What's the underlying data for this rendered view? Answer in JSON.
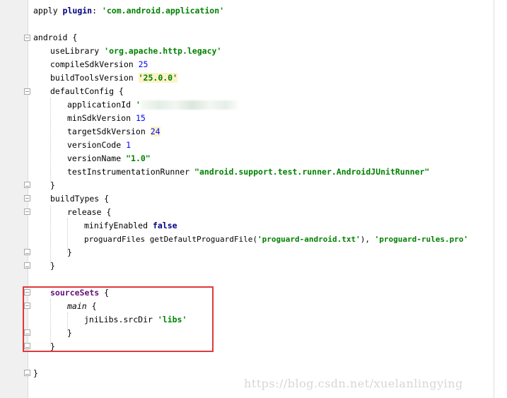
{
  "code": {
    "l1_apply": "apply ",
    "l1_plugin": "plugin",
    "l1_colon": ": ",
    "l1_str": "'com.android.application'",
    "l2_android": "android {",
    "l3_use": "useLibrary ",
    "l3_str": "'org.apache.http.legacy'",
    "l4_key": "compileSdkVersion ",
    "l4_val": "25",
    "l5_key": "buildToolsVersion ",
    "l5_val": "'25.0.0'",
    "l6": "defaultConfig {",
    "l7_key": "applicationId ",
    "l7_quote": "'",
    "l8_key": "minSdkVersion ",
    "l8_val": "15",
    "l9_key": "targetSdkVersion ",
    "l9_val": "24",
    "l10_key": "versionCode ",
    "l10_val": "1",
    "l11_key": "versionName ",
    "l11_val": "\"1.0\"",
    "l12_key": "testInstrumentationRunner ",
    "l12_val": "\"android.support.test.runner.AndroidJUnitRunner\"",
    "close": "}",
    "l14": "buildTypes {",
    "l15": "release {",
    "l16_key": "minifyEnabled ",
    "l16_val": "false",
    "l17_key": "proguardFiles getDefaultProguardFile(",
    "l17_str1": "'proguard-android.txt'",
    "l17_mid": "), ",
    "l17_str2": "'proguard-rules.pro'",
    "l21_name": "sourceSets",
    "brace_open": " {",
    "l22_name": "main",
    "l23_key": "jniLibs.srcDir ",
    "l23_str": "'libs'"
  },
  "watermark": "https://blog.csdn.net/xuelanlingying"
}
